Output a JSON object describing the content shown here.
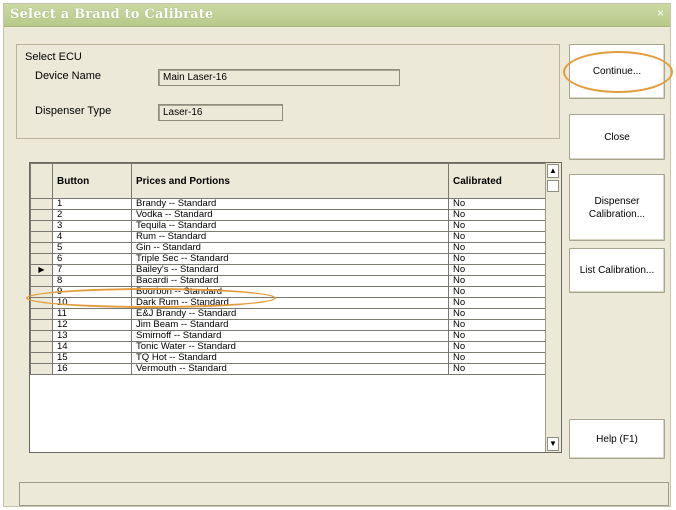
{
  "window": {
    "title": "Select a Brand to Calibrate"
  },
  "ecu": {
    "group_label": "Select ECU",
    "device_name_label": "Device Name",
    "device_name_value": "Main Laser-16",
    "dispenser_type_label": "Dispenser Type",
    "dispenser_type_value": "Laser-16"
  },
  "buttons": {
    "continue": "Continue...",
    "close": "Close",
    "dispenser_calibration_line1": "Dispenser",
    "dispenser_calibration_line2": "Calibration...",
    "list_calibration": "List Calibration...",
    "help": "Help (F1)"
  },
  "grid": {
    "columns": [
      "Button",
      "Prices and Portions",
      "Calibrated"
    ],
    "current_row_marker": "▶",
    "rows": [
      {
        "button": "1",
        "item": "Brandy -- Standard",
        "calibrated": "No"
      },
      {
        "button": "2",
        "item": "Vodka -- Standard",
        "calibrated": "No"
      },
      {
        "button": "3",
        "item": "Tequila -- Standard",
        "calibrated": "No"
      },
      {
        "button": "4",
        "item": "Rum -- Standard",
        "calibrated": "No"
      },
      {
        "button": "5",
        "item": "Gin -- Standard",
        "calibrated": "No"
      },
      {
        "button": "6",
        "item": "Triple Sec -- Standard",
        "calibrated": "No"
      },
      {
        "button": "7",
        "item": "Bailey's -- Standard",
        "calibrated": "No"
      },
      {
        "button": "8",
        "item": "Bacardi -- Standard",
        "calibrated": "No"
      },
      {
        "button": "9",
        "item": "Bourbon -- Standard",
        "calibrated": "No"
      },
      {
        "button": "10",
        "item": "Dark Rum -- Standard",
        "calibrated": "No"
      },
      {
        "button": "11",
        "item": "E&J Brandy -- Standard",
        "calibrated": "No"
      },
      {
        "button": "12",
        "item": "Jim Beam -- Standard",
        "calibrated": "No"
      },
      {
        "button": "13",
        "item": "Smirnoff -- Standard",
        "calibrated": "No"
      },
      {
        "button": "14",
        "item": "Tonic Water -- Standard",
        "calibrated": "No"
      },
      {
        "button": "15",
        "item": "TQ Hot -- Standard",
        "calibrated": "No"
      },
      {
        "button": "16",
        "item": "Vermouth -- Standard",
        "calibrated": "No"
      }
    ]
  },
  "status": {
    "text": ""
  },
  "colors": {
    "highlight": "#e39c3d",
    "window_bg": "#ece9d8",
    "title_bg": "#b7c98a"
  }
}
